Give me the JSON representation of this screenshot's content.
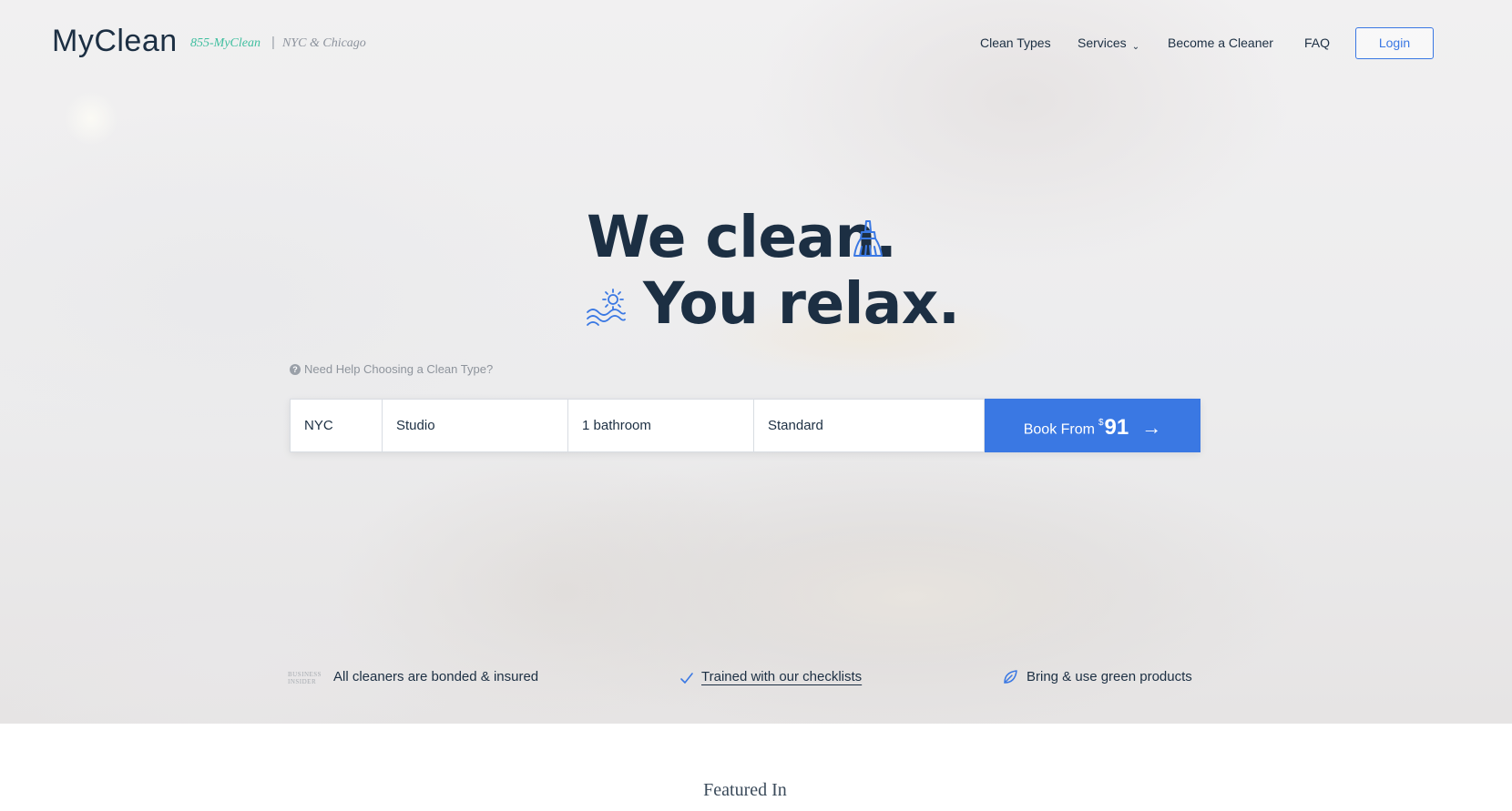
{
  "header": {
    "logo": "MyClean",
    "phone": "855-MyClean",
    "separator": "|",
    "cities": "NYC & Chicago",
    "nav": [
      {
        "label": "Clean Types"
      },
      {
        "label": "Services"
      },
      {
        "label": "Become a Cleaner"
      },
      {
        "label": "FAQ"
      }
    ],
    "login_label": "Login"
  },
  "hero": {
    "line1": "We clean.",
    "line2": "You relax.",
    "line1_icon": "broom-icon",
    "line2_icon": "sun-waves-icon",
    "help_text": "Need Help Choosing a Clean Type?"
  },
  "booking": {
    "city": "NYC",
    "home_size": "Studio",
    "bathrooms": "1 bathroom",
    "clean_type": "Standard",
    "book_label": "Book From",
    "currency": "$",
    "price": "91",
    "arrow": "→"
  },
  "badges": [
    {
      "icon": "business-insider-logo",
      "logo_text": "BUSINESS INSIDER",
      "text": "All cleaners are bonded & insured"
    },
    {
      "icon": "check-icon",
      "text": "Trained with our checklists"
    },
    {
      "icon": "leaf-icon",
      "text": "Bring & use green products"
    }
  ],
  "featured": {
    "title": "Featured In"
  },
  "colors": {
    "primary": "#3a78e3",
    "navy": "#1c2f43",
    "phone_green": "#3fbf9f"
  }
}
